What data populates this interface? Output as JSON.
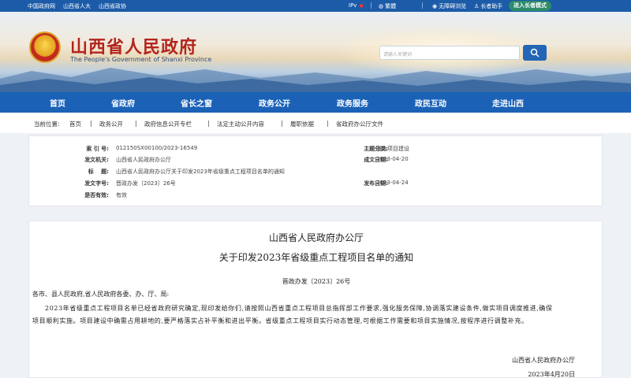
{
  "topbar": {
    "links": [
      "中国政府网",
      "山西省人大",
      "山西省政协"
    ],
    "ipv6": "IPv",
    "traditional": "繁體",
    "accessible": "无障碍浏览",
    "elder_helper": "长者助手",
    "elder_mode": "进入长者模式"
  },
  "header": {
    "title": "山西省人民政府",
    "subtitle": "The People's Government of Shanxi Province",
    "search_placeholder": "请输入关键词"
  },
  "nav": [
    "首页",
    "省政府",
    "省长之窗",
    "政务公开",
    "政务服务",
    "政民互动",
    "走进山西"
  ],
  "breadcrumb": {
    "label": "当前位置:",
    "items": [
      "首页",
      "政务公开",
      "政府信息公开专栏",
      "法定主动公开内容",
      "履职依据",
      "省政府办公厅文件"
    ]
  },
  "meta": {
    "index_k": "索 引 号:",
    "index_v": "012150SX00100/2023-16549",
    "category_k": "主题分类:",
    "category_v": "重大项目建设",
    "issuer_k": "发文机关:",
    "issuer_v": "山西省人民政府办公厅",
    "created_k": "成文日期:",
    "created_v": "2023-04-20",
    "title_k": "标　 题:",
    "title_v": "山西省人民政府办公厅关于印发2023年省级重点工程项目名单的通知",
    "docno_k": "发文字号:",
    "docno_v": "晋政办发〔2023〕26号",
    "published_k": "发布日期:",
    "published_v": "2023-04-24",
    "valid_k": "是否有效:",
    "valid_v": "有效"
  },
  "article": {
    "title1": "山西省人民政府办公厅",
    "title2": "关于印发2023年省级重点工程项目名单的通知",
    "docno": "晋政办发〔2023〕26号",
    "greeting": "各市、县人民政府,省人民政府各委、办、厅、局:",
    "body": "2023年省级重点工程项目名单已经省政府研究确定,现印发给你们,请按照山西省重点工程项目总指挥部工作要求,强化服务保障,协调落实建设条件,做实项目调度推进,确保项目顺利实施。项目建设中确需占用耕地的,要严格落实占补平衡和进出平衡。省级重点工程项目实行动态管理,可根据工作需要和项目实施情况,按程序进行调整补充。",
    "signature": "山西省人民政府办公厅",
    "date": "2023年4月20日"
  }
}
